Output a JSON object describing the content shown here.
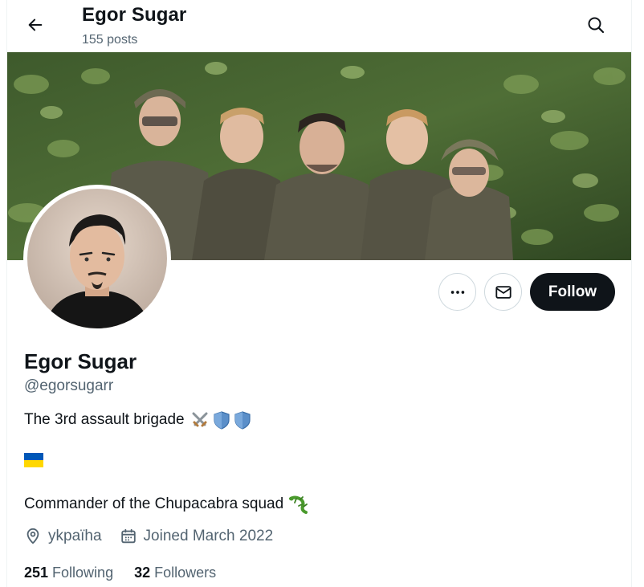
{
  "header": {
    "title": "Egor Sugar",
    "post_count": "155 posts"
  },
  "actions": {
    "follow_label": "Follow"
  },
  "profile": {
    "name": "Egor Sugar",
    "handle": "@egorsugarr",
    "bio_line1": "The 3rd assault brigade",
    "bio_line3": "Commander of the Chupacabra squad",
    "location": "ykpaïha",
    "joined": "Joined March 2022"
  },
  "stats": {
    "following_count": "251",
    "following_label": "Following",
    "followers_count": "32",
    "followers_label": "Followers"
  },
  "colors": {
    "text_primary": "#0f1419",
    "text_secondary": "#536471",
    "border": "#cfd9de",
    "follow_bg": "#0f1419"
  },
  "icons": {
    "back": "arrow-left-icon",
    "search": "search-icon",
    "more": "more-horizontal-icon",
    "message": "envelope-icon",
    "location": "location-pin-icon",
    "calendar": "calendar-icon",
    "swords": "crossed-swords-emoji",
    "shield": "shield-emoji",
    "flag": "ukraine-flag-emoji",
    "lizard": "lizard-emoji"
  }
}
